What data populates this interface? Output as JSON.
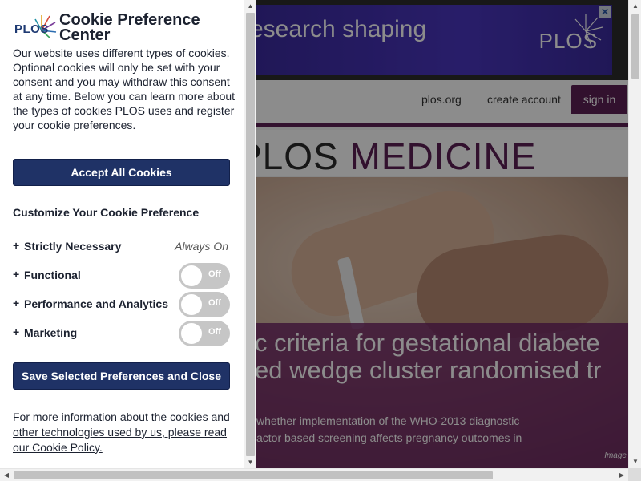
{
  "background": {
    "ad": {
      "text": "esearch shaping",
      "logo": "PLOS",
      "close": "✕"
    },
    "nav": {
      "plos_org": "plos.org",
      "create_account": "create account",
      "sign_in": "sign in"
    },
    "masthead": {
      "plos": "PLOS",
      "medicine": "MEDICINE"
    },
    "hero": {
      "title_line1": "c criteria for gestational diabete",
      "title_line2": "ed wedge cluster randomised tr",
      "body_line1": "whether implementation of the WHO-2013 diagnostic",
      "body_line2": "actor based screening affects pregnancy outcomes in",
      "credit": "Image"
    }
  },
  "cookie_panel": {
    "logo_text": "PLOS",
    "title": "Cookie Preference Center",
    "description": "Our website uses different types of cookies. Optional cookies will only be set with your consent and you may withdraw this consent at any time. Below you can learn more about the types of cookies PLOS uses and register your cookie preferences.",
    "accept_all_label": "Accept All Cookies",
    "customize_title": "Customize Your Cookie Preference",
    "categories": [
      {
        "label": "Strictly Necessary",
        "status": "Always On"
      },
      {
        "label": "Functional",
        "toggle": "Off"
      },
      {
        "label": "Performance and Analytics",
        "toggle": "Off"
      },
      {
        "label": "Marketing",
        "toggle": "Off"
      }
    ],
    "expand_symbol": "+",
    "save_label": "Save Selected Preferences and Close",
    "policy_link": "For more information about the cookies and other technologies used by us, please read our Cookie Policy."
  },
  "colors": {
    "button_navy": "#1f3266",
    "brand_purple": "#5b1f55",
    "toggle_off": "#c6c6c6"
  }
}
